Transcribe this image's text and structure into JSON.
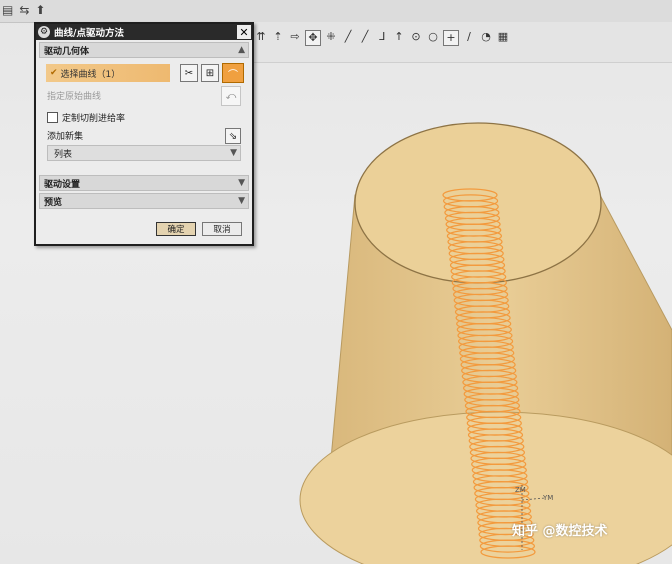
{
  "toolbar": {
    "left_icons": [
      "doc-icon",
      "swap-icon",
      "arrow-icon"
    ],
    "icons": [
      {
        "name": "arrows-up-icon",
        "glyph": "⇈"
      },
      {
        "name": "arrow-hub-icon",
        "glyph": "⇡"
      },
      {
        "name": "move-icon",
        "glyph": "⇨"
      },
      {
        "name": "snap-point-icon",
        "glyph": "✥",
        "boxed": true
      },
      {
        "name": "snap-node-icon",
        "glyph": "⁜"
      },
      {
        "name": "line-icon",
        "glyph": "╱"
      },
      {
        "name": "polyline-icon",
        "glyph": "╱"
      },
      {
        "name": "curve-icon",
        "glyph": "ᒧ"
      },
      {
        "name": "tangent-icon",
        "glyph": "↑"
      },
      {
        "name": "circle-center-icon",
        "glyph": "⊙"
      },
      {
        "name": "circle-icon",
        "glyph": "○"
      },
      {
        "name": "plus-icon",
        "glyph": "+",
        "boxed": true
      },
      {
        "name": "slash-icon",
        "glyph": "∕"
      },
      {
        "name": "dot-icon",
        "glyph": "◔"
      },
      {
        "name": "grid-icon",
        "glyph": "▦"
      }
    ]
  },
  "dialog": {
    "title": "曲线/点驱动方法",
    "section_drive_geometry": "驱动几何体",
    "select_curve_label": "选择曲线（1）",
    "specify_origin_curve": "指定原始曲线",
    "custom_feed_label": "定制切削进给率",
    "add_new_set": "添加新集",
    "list_label": "列表",
    "section_drive_settings": "驱动设置",
    "section_preview": "预览",
    "ok_label": "确定",
    "cancel_label": "取消"
  },
  "viewport": {
    "axis_zm": "ZM",
    "axis_ym": "YM",
    "watermark": "知乎 @数控技术"
  },
  "colors": {
    "cone": "#e8c98e",
    "helix": "#f39a3d",
    "dialog_title_bg": "#2a2a2a",
    "selection_bar": "#f0c07c"
  }
}
